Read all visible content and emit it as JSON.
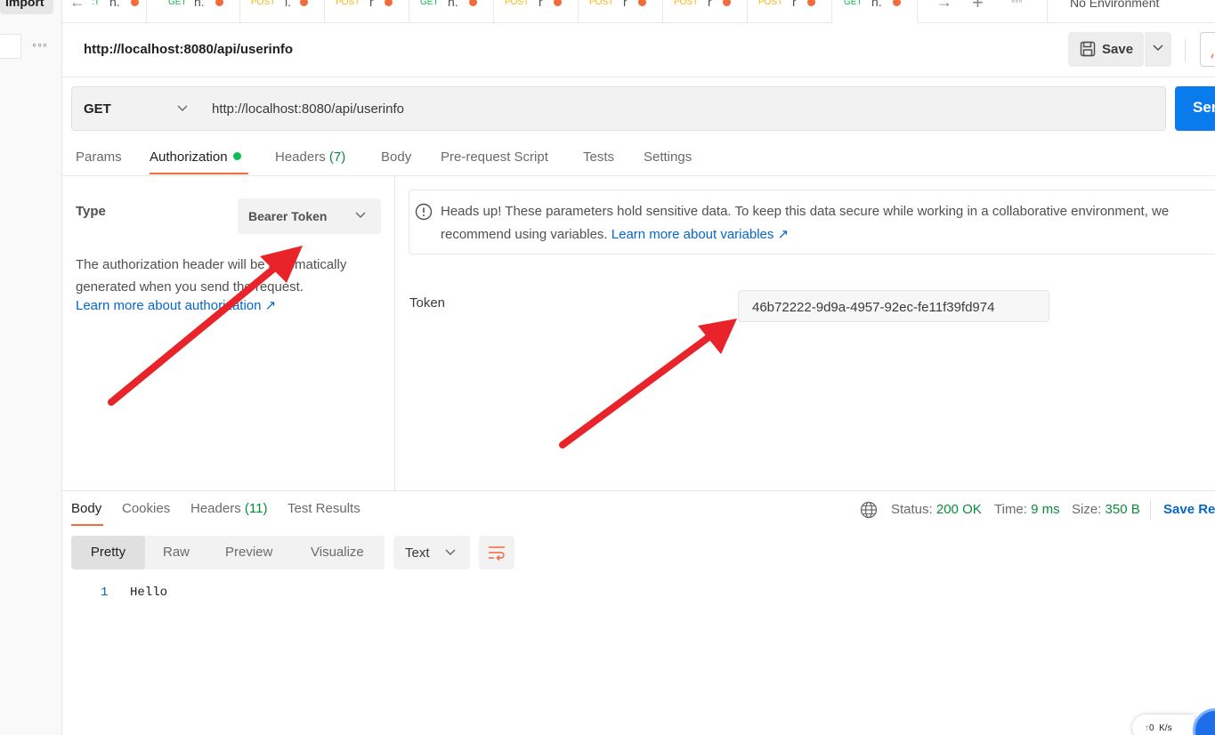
{
  "sidebar": {
    "import_label": "Import",
    "more": "◦◦◦"
  },
  "tabs": [
    {
      "method": ":T",
      "title": "h.",
      "method_type": "get"
    },
    {
      "method": "GET",
      "title": "h.",
      "method_type": "get"
    },
    {
      "method": "POST",
      "title": "l.",
      "method_type": "post"
    },
    {
      "method": "POST",
      "title": "r",
      "method_type": "post"
    },
    {
      "method": "GET",
      "title": "h.",
      "method_type": "get"
    },
    {
      "method": "POST",
      "title": "r",
      "method_type": "post"
    },
    {
      "method": "POST",
      "title": "r",
      "method_type": "post"
    },
    {
      "method": "POST",
      "title": "r",
      "method_type": "post"
    },
    {
      "method": "POST",
      "title": "r",
      "method_type": "post"
    },
    {
      "method": "GET",
      "title": "h.",
      "method_type": "get"
    }
  ],
  "tabbar": {
    "more": "◦◦◦",
    "environment": "No Environment"
  },
  "request": {
    "title": "http://localhost:8080/api/userinfo",
    "save_label": "Save",
    "method": "GET",
    "url": "http://localhost:8080/api/userinfo",
    "send_label": "Send"
  },
  "request_tabs": {
    "params": "Params",
    "authorization": "Authorization",
    "headers": "Headers",
    "headers_count": "(7)",
    "body": "Body",
    "prerequest": "Pre-request Script",
    "tests": "Tests",
    "settings": "Settings"
  },
  "auth": {
    "type_label": "Type",
    "type_value": "Bearer Token",
    "description": "The authorization header will be automatically generated when you send the request.",
    "learn_more": "Learn more about authorization ↗",
    "notice_line1": "Heads up! These parameters hold sensitive data. To keep this data secure while working in a collaborative environment, we",
    "notice_line2": "recommend using variables.",
    "notice_link": "Learn more about variables ↗",
    "token_label": "Token",
    "token_value": "46b72222-9d9a-4957-92ec-fe11f39fd974"
  },
  "response": {
    "tabs": {
      "body": "Body",
      "cookies": "Cookies",
      "headers": "Headers",
      "headers_count": "(11)",
      "test_results": "Test Results"
    },
    "status_label": "Status:",
    "status_value": "200 OK",
    "time_label": "Time:",
    "time_value": "9 ms",
    "size_label": "Size:",
    "size_value": "350 B",
    "save_response": "Save Response",
    "formats": [
      "Pretty",
      "Raw",
      "Preview",
      "Visualize"
    ],
    "text_type": "Text",
    "line_number": "1",
    "line_content": "Hello"
  },
  "statusbar": {
    "speed_value": "0",
    "speed_unit": "K/s"
  },
  "colors": {
    "accent": "#f26b3a",
    "send": "#097bed",
    "get": "#0cbb52",
    "post": "#ffb400",
    "arrow": "#e8232a"
  }
}
